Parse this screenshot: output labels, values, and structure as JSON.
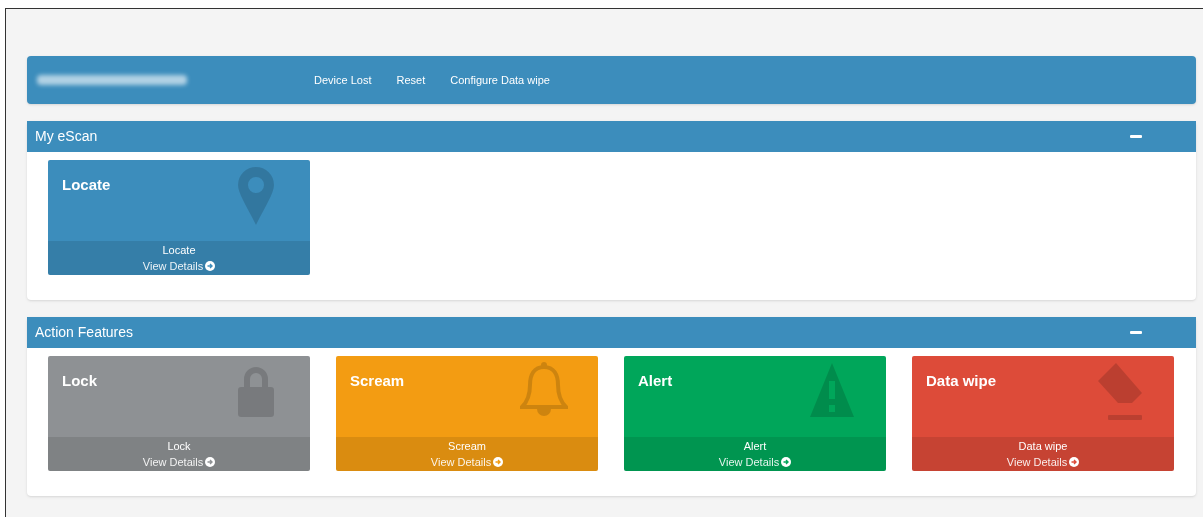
{
  "header": {
    "links": [
      "Device Lost",
      "Reset",
      "Configure Data wipe"
    ]
  },
  "panels": [
    {
      "title": "My eScan",
      "expanded": true,
      "tiles": [
        {
          "title": "Locate",
          "label": "Locate",
          "link": "View Details",
          "color": "#3c8dbc",
          "kind": "pin"
        }
      ]
    },
    {
      "title": "Action Features",
      "expanded": true,
      "tiles": [
        {
          "title": "Lock",
          "label": "Lock",
          "link": "View Details",
          "color": "#8e9194",
          "kind": "lock"
        },
        {
          "title": "Scream",
          "label": "Scream",
          "link": "View Details",
          "color": "#f39c12",
          "kind": "bell"
        },
        {
          "title": "Alert",
          "label": "Alert",
          "link": "View Details",
          "color": "#00a65a",
          "kind": "warning"
        },
        {
          "title": "Data wipe",
          "label": "Data wipe",
          "link": "View Details",
          "color": "#dd4b39",
          "kind": "eraser"
        }
      ]
    }
  ]
}
